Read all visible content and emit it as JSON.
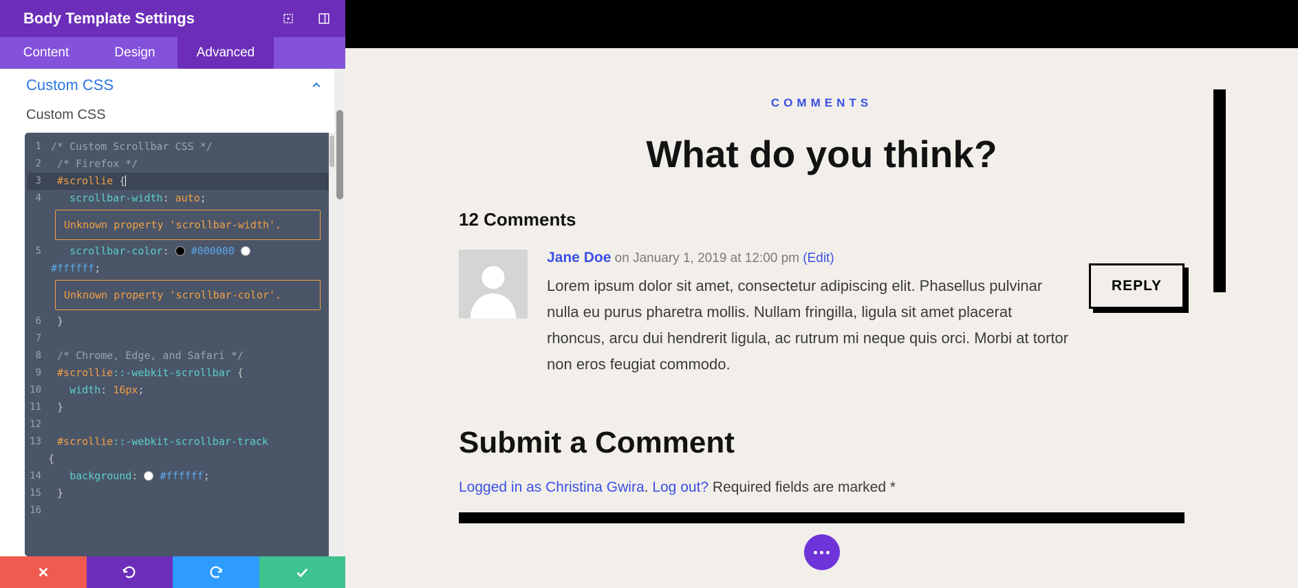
{
  "sidebar": {
    "title": "Body Template Settings",
    "tabs": {
      "content": "Content",
      "design": "Design",
      "advanced": "Advanced"
    },
    "accordion": {
      "title": "Custom CSS",
      "subhead": "Custom CSS"
    }
  },
  "code": {
    "line1": "/* Custom Scrollbar CSS */",
    "line2": "/* Firefox */",
    "line3_sel": "#scrollie",
    "line3_b": " {",
    "line4_prop": "scrollbar-width",
    "line4_val": "auto",
    "warn1": "Unknown property 'scrollbar-width'.",
    "line5_prop": "scrollbar-color",
    "line5_h1": "#000000",
    "line5_h2": "#ffffff",
    "warn2": "Unknown property 'scrollbar-color'.",
    "line6": "}",
    "line8": "/* Chrome, Edge, and Safari */",
    "line9_sel": "#scrollie",
    "line9_ps": "::-webkit-scrollbar",
    "line9_b": " {",
    "line10_prop": "width",
    "line10_val": "16px",
    "line11": "}",
    "line13_sel": "#scrollie",
    "line13_ps": "::-webkit-scrollbar-track",
    "line13_b": " {",
    "line14_prop": "background",
    "line14_hex": "#ffffff",
    "line15": "}"
  },
  "preview": {
    "overline": "COMMENTS",
    "headline": "What do you think?",
    "count": "12 Comments",
    "comment": {
      "author": "Jane Doe",
      "on": "on",
      "datetime": "January 1, 2019 at 12:00 pm",
      "edit": "(Edit)",
      "text": "Lorem ipsum dolor sit amet, consectetur adipiscing elit. Phasellus pulvinar nulla eu purus pharetra mollis. Nullam fringilla, ligula sit amet placerat rhoncus, arcu dui hendrerit ligula, ac rutrum mi neque quis orci. Morbi at tortor non eros feugiat commodo.",
      "reply": "REPLY"
    },
    "submit": {
      "title": "Submit a Comment",
      "logged_pre": "Logged in as ",
      "user": "Christina Gwira",
      "dot": ". ",
      "logout": "Log out?",
      "req": " Required fields are marked *"
    }
  }
}
